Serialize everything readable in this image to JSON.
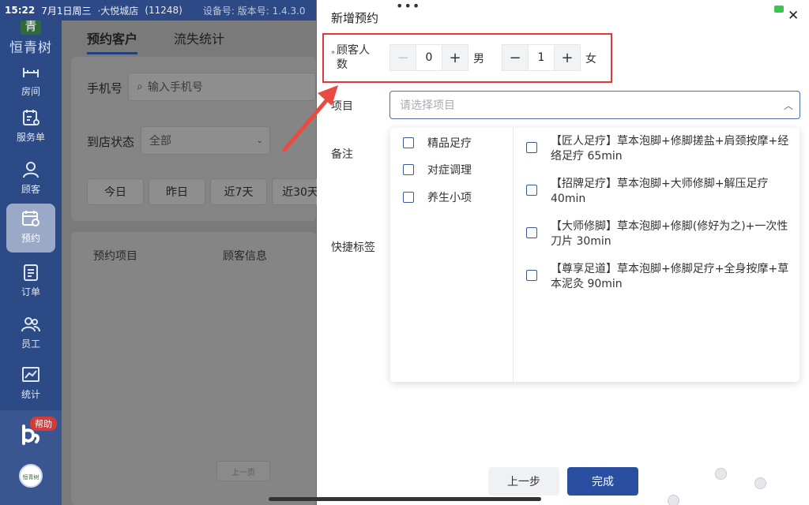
{
  "status_bar": {
    "time": "15:22",
    "date": "7月1日周三",
    "store": "·大悦城店",
    "store_code": "(11248)",
    "device": "设备号: 版本号: 1.4.3.0"
  },
  "sidebar": {
    "logo_badge": "青",
    "logo_name": "恒青树",
    "items": [
      {
        "label": "房间",
        "icon": "room-icon",
        "active": false
      },
      {
        "label": "服务单",
        "icon": "service-order-icon",
        "active": false
      },
      {
        "label": "顾客",
        "icon": "customer-icon",
        "active": false
      },
      {
        "label": "预约",
        "icon": "appointment-icon",
        "active": true
      },
      {
        "label": "订单",
        "icon": "order-icon",
        "active": false
      },
      {
        "label": "员工",
        "icon": "staff-icon",
        "active": false
      },
      {
        "label": "统计",
        "icon": "stats-icon",
        "active": false
      }
    ],
    "help_badge": "帮助",
    "avatar_text": "恒青树"
  },
  "background_page": {
    "tabs": [
      "预约客户",
      "流失统计"
    ],
    "phone_label": "手机号",
    "phone_placeholder": "输入手机号",
    "status_label": "到店状态",
    "status_value": "全部",
    "date_buttons": [
      "今日",
      "昨日",
      "近7天",
      "近30天"
    ],
    "table_headers": [
      "预约项目",
      "顾客信息"
    ],
    "pager_prev": "上一页"
  },
  "drawer": {
    "title": "新增预约",
    "customer_count_label": "顾客人数",
    "male": {
      "value": "0",
      "label": "男"
    },
    "female": {
      "value": "1",
      "label": "女"
    },
    "minus": "−",
    "plus": "+",
    "project_label": "项目",
    "project_placeholder": "请选择项目",
    "remark_label": "备注",
    "quick_tag_label": "快捷标签",
    "categories": [
      "精品足疗",
      "对症调理",
      "养生小项"
    ],
    "items": [
      "【匠人足疗】草本泡脚+修脚搓盐+肩颈按摩+经络足疗 65min",
      "【招牌足疗】草本泡脚+大师修脚+解压足疗 40min",
      "【大师修脚】草本泡脚+修脚(修好为之)+一次性刀片 30min",
      "【尊享足道】草本泡脚+修脚足疗+全身按摩+草本泥灸 90min"
    ],
    "prev_button": "上一步",
    "done_button": "完成"
  },
  "colors": {
    "sidebar_bg": "#2b4a86",
    "primary": "#2b4fa0",
    "highlight": "#e1373c"
  }
}
